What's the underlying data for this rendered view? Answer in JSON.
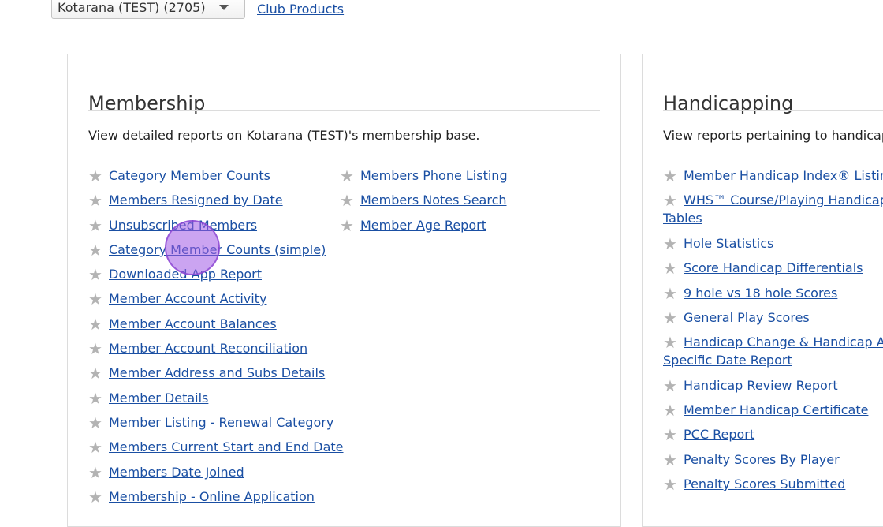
{
  "header": {
    "club_select_value": "Kotarana (TEST) (2705)",
    "club_products_link": "Club Products"
  },
  "membership": {
    "title": "Membership",
    "description": "View detailed reports on Kotarana (TEST)'s membership base.",
    "col1": [
      "Category Member Counts",
      "Members Resigned by Date",
      "Unsubscribed Members",
      "Category Member Counts (simple)",
      "Downloaded App Report",
      "Member Account Activity",
      "Member Account Balances",
      "Member Account Reconciliation",
      "Member Address and Subs Details",
      "Member Details",
      "Member Listing - Renewal Category",
      "Members Current Start and End Date",
      "Members Date Joined",
      "Membership - Online Application"
    ],
    "col2": [
      "Members Phone Listing",
      "Members Notes Search",
      "Member Age Report"
    ]
  },
  "handicapping": {
    "title": "Handicapping",
    "description": "View reports pertaining to handicapp",
    "items": [
      "Member Handicap Index® Listing",
      "WHS™ Course/Playing Handicap Tables",
      "Hole Statistics",
      "Score Handicap Differentials",
      "9 hole vs 18 hole Scores",
      "General Play Scores",
      "Handicap Change & Handicap At Specific Date Report",
      "Handicap Review Report",
      "Member Handicap Certificate",
      "PCC Report",
      "Penalty Scores By Player",
      "Penalty Scores Submitted"
    ]
  },
  "icons": {
    "favourite": "star-icon",
    "dropdown": "chevron-down-icon"
  },
  "colors": {
    "link": "#1a4fa3",
    "star": "#b3b3b3",
    "cursor": "#a05ae6"
  }
}
